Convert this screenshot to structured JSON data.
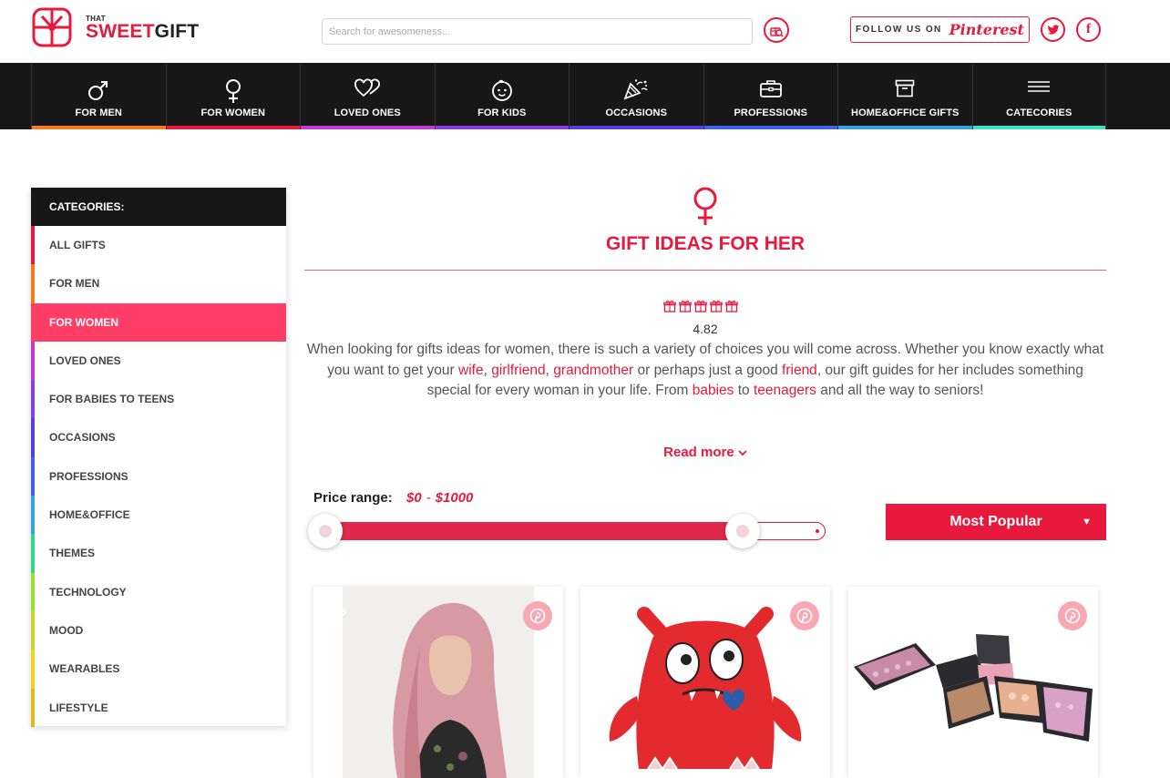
{
  "brand": {
    "that": "THAT",
    "sweet": "SWEET",
    "gift": "GIFT",
    "accent": "#e8193c"
  },
  "search": {
    "placeholder": "Search for awesomeness..."
  },
  "follow": {
    "label": "FOLLOW US ON",
    "brand": "Pinterest"
  },
  "social": [
    {
      "icon": "twitter-icon"
    },
    {
      "icon": "facebook-icon",
      "glyph": "f"
    }
  ],
  "nav": {
    "items": [
      {
        "label": "FOR MEN",
        "icon": "mars-icon",
        "color": "#f47a1f"
      },
      {
        "label": "FOR WOMEN",
        "icon": "venus-icon",
        "color": "#e8193c"
      },
      {
        "label": "LOVED ONES",
        "icon": "hearts-icon",
        "color": "#c23ad6"
      },
      {
        "label": "FOR KIDS",
        "icon": "baby-icon",
        "color": "#8a3ee0"
      },
      {
        "label": "OCCASIONS",
        "icon": "party-popper-icon",
        "color": "#5a3fe0"
      },
      {
        "label": "PROFESSIONS",
        "icon": "briefcase-icon",
        "color": "#3f63e6"
      },
      {
        "label": "HOME&OFFICE GIFTS",
        "icon": "archive-box-icon",
        "color": "#36a3e6"
      },
      {
        "label": "CATECORIES",
        "icon": "menu-icon",
        "color": "#3fe0c8"
      }
    ]
  },
  "sidebar": {
    "heading": "CATEGORIES:",
    "items": [
      {
        "label": "ALL GIFTS",
        "color": "#e8193c",
        "active": false
      },
      {
        "label": "FOR MEN",
        "color": "#f47a1f",
        "active": false
      },
      {
        "label": "FOR WOMEN",
        "color": "#e8193c",
        "active": true
      },
      {
        "label": "LOVED ONES",
        "color": "#c23ad6",
        "active": false
      },
      {
        "label": "FOR BABIES TO TEENS",
        "color": "#8a3ee0",
        "active": false
      },
      {
        "label": "OCCASIONS",
        "color": "#5a3fe0",
        "active": false
      },
      {
        "label": "PROFESSIONS",
        "color": "#3f63e6",
        "active": false
      },
      {
        "label": "HOME&OFFICE",
        "color": "#36a3e6",
        "active": false
      },
      {
        "label": "THEMES",
        "color": "#2fd98a",
        "active": false
      },
      {
        "label": "TECHNOLOGY",
        "color": "#98e032",
        "active": false
      },
      {
        "label": "MOOD",
        "color": "#c6d62a",
        "active": false
      },
      {
        "label": "WEARABLES",
        "color": "#f2d21a",
        "active": false
      },
      {
        "label": "LIFESTYLE",
        "color": "#e0b81c",
        "active": false
      }
    ]
  },
  "main": {
    "title": "GIFT IDEAS FOR HER",
    "rating": {
      "value": "4.82",
      "icons": 5
    },
    "intro": {
      "p1": "When looking for gifts ideas for women, there is such a variety of choices you will come across. Whether you know exactly what you want to get your ",
      "link_wife": "wife",
      "sep1": ", ",
      "link_girlfriend": "girlfriend",
      "sep2": ", ",
      "link_grandmother": "grandmother",
      "p2": " or perhaps just a good ",
      "link_friend": "friend",
      "p3": ", our gift guides for her includes something special for every woman in your life. From ",
      "link_babies": "babies",
      "p4": " to ",
      "link_teenagers": "teenagers",
      "p5": " and all the way to seniors!"
    },
    "read_more": "Read more",
    "price": {
      "label": "Price range:",
      "min": "$0",
      "max": "$1000",
      "dash": "-",
      "fill_fraction": 0.85
    },
    "sort": {
      "selected": "Most Popular"
    },
    "products": [
      {
        "name": "woman-portrait",
        "likes": "6"
      },
      {
        "name": "red-monster-plush",
        "likes": ""
      },
      {
        "name": "makeup-palette-case",
        "likes": ""
      }
    ]
  }
}
